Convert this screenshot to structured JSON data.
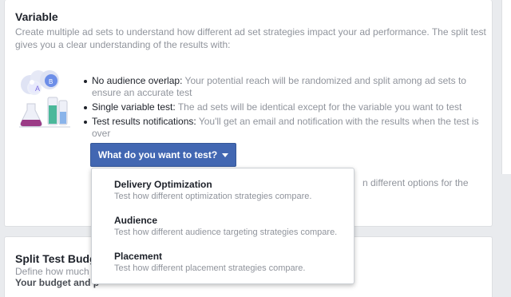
{
  "variable_section": {
    "title": "Variable",
    "description": "Create multiple ad sets to understand how different ad set strategies impact your ad performance. The split test gives you a clear understanding of the results with:",
    "illustration": {
      "icon": "lab-flasks-illustration",
      "bubble_a": "A",
      "bubble_b": "B"
    },
    "bullets": [
      {
        "term": "No audience overlap:",
        "text": " Your potential reach will be randomized and split among ad sets to ensure an accurate test"
      },
      {
        "term": "Single variable test:",
        "text": " The ad sets will be identical except for the variable you want to test"
      },
      {
        "term": "Test results notifications:",
        "text": " You'll get an email and notification with the results when the test is over"
      }
    ],
    "dropdown_button": "What do you want to test?",
    "obscured_text": "n different options for the"
  },
  "dropdown_menu": {
    "items": [
      {
        "title": "Delivery Optimization",
        "desc": "Test how different optimization strategies compare."
      },
      {
        "title": "Audience",
        "desc": "Test how different audience targeting strategies compare."
      },
      {
        "title": "Placement",
        "desc": "Test how different placement strategies compare."
      }
    ]
  },
  "budget_section": {
    "title": "Split Test Budg",
    "desc_line1": "Define how much y",
    "desc_line2": "Your budget and p"
  },
  "colors": {
    "accent": "#4267b2",
    "text_dark": "#1d2129",
    "text_muted": "#90949c",
    "background": "#e9ebee"
  }
}
